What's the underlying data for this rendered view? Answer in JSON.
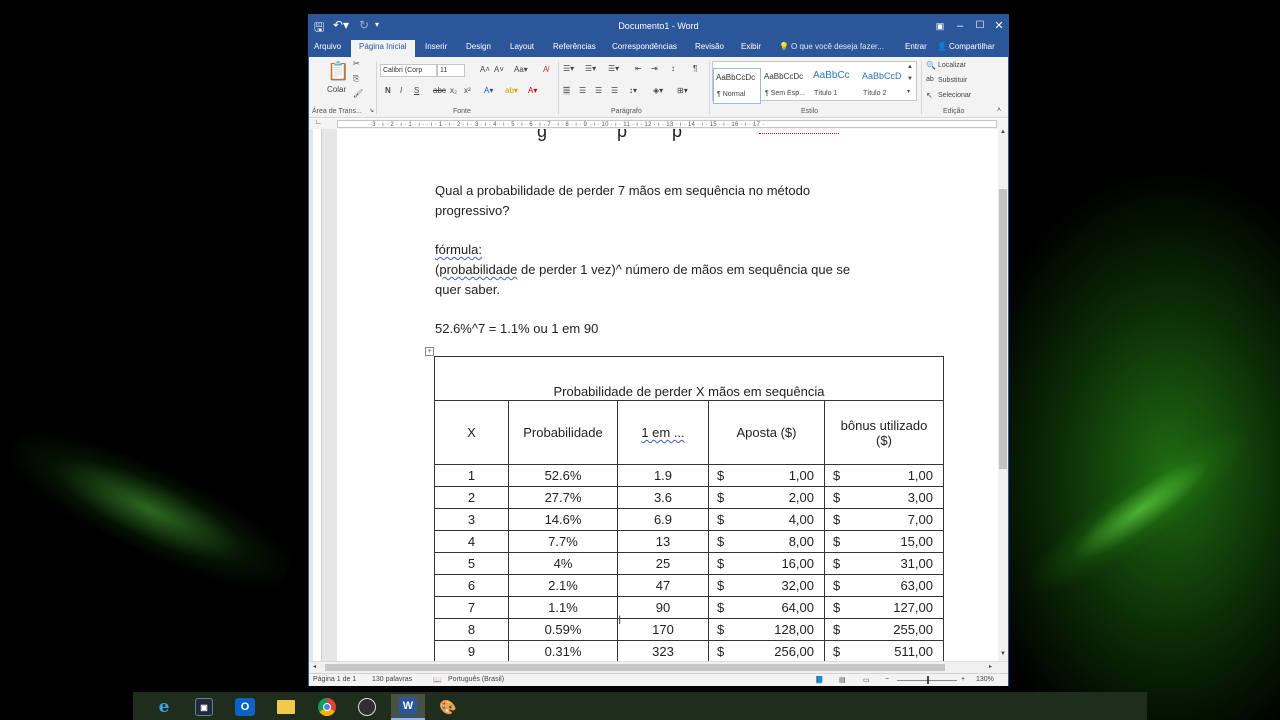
{
  "window": {
    "title": "Documento1 - Word",
    "quick_access": {
      "save_icon": "save-icon",
      "undo_icon": "undo-icon",
      "redo_icon": "redo-icon",
      "customize_icon": "customize-icon"
    },
    "controls": {
      "ribbon_display_icon": "ribbon-display-icon",
      "minimize_icon": "minimize-icon",
      "maximize_icon": "maximize-icon",
      "close_icon": "close-icon"
    }
  },
  "tabs": [
    "Arquivo",
    "Página Inicial",
    "Inserir",
    "Design",
    "Layout",
    "Referências",
    "Correspondências",
    "Revisão",
    "Exibir"
  ],
  "tell_me": "O que você deseja fazer...",
  "signin": "Entrar",
  "share": "Compartilhar",
  "ribbon": {
    "clipboard": {
      "paste_label": "Colar",
      "group_label": "Área de Trans..."
    },
    "font": {
      "font_name": "Calibri (Corp",
      "font_size": "11",
      "group_label": "Fonte"
    },
    "paragraph": {
      "group_label": "Parágrafo"
    },
    "styles": {
      "items": [
        {
          "preview": "AaBbCcDc",
          "name": "¶ Normal"
        },
        {
          "preview": "AaBbCcDc",
          "name": "¶ Sem Esp..."
        },
        {
          "preview": "AaBbCc",
          "name": "Título 1"
        },
        {
          "preview": "AaBbCcD",
          "name": "Título 2"
        }
      ],
      "group_label": "Estilo"
    },
    "editing": {
      "find": "Localizar",
      "replace": "Substituir",
      "select": "Selecionar",
      "group_label": "Edição"
    }
  },
  "ruler": "· 3 · ı · 2 · ı · 1 · ı ·   · ı · 1 · ı · 2 · ı · 3 · ı · 4 · ı · 5 · ı · 6 · ı · 7 · ı · 8 · ı · 9 · ı · 10 · ı · 11 · ı · 12 · ı · 13 · ı · 14 · ı · 15 · ı · 16 · ı · 17 ·",
  "document": {
    "question_line1": "Qual a probabilidade de perder 7 mãos em sequência no método",
    "question_line2": "progressivo?",
    "formula_label": "fórmula:",
    "formula_paren": "(",
    "formula_squig": "probabilidade",
    "formula_rest": " de perder 1 vez)^ número de mãos em sequência que se",
    "formula_line2": "quer saber.",
    "result": "52.6%^7 = 1.1% ou 1 em 90",
    "table": {
      "caption": "Probabilidade de perder X mãos em sequência",
      "headers": [
        "X",
        "Probabilidade",
        "1 em ...",
        "Aposta ($)",
        "bônus utilizado ($)"
      ],
      "rows": [
        [
          "1",
          "52.6%",
          "1.9",
          "$",
          "1,00",
          "$",
          "1,00"
        ],
        [
          "2",
          "27.7%",
          "3.6",
          "$",
          "2,00",
          "$",
          "3,00"
        ],
        [
          "3",
          "14.6%",
          "6.9",
          "$",
          "4,00",
          "$",
          "7,00"
        ],
        [
          "4",
          "7.7%",
          "13",
          "$",
          "8,00",
          "$",
          "15,00"
        ],
        [
          "5",
          "4%",
          "25",
          "$",
          "16,00",
          "$",
          "31,00"
        ],
        [
          "6",
          "2.1%",
          "47",
          "$",
          "32,00",
          "$",
          "63,00"
        ],
        [
          "7",
          "1.1%",
          "90",
          "$",
          "64,00",
          "$",
          "127,00"
        ],
        [
          "8",
          "0.59%",
          "170",
          "$",
          "128,00",
          "$",
          "255,00"
        ],
        [
          "9",
          "0.31%",
          "323",
          "$",
          "256,00",
          "$",
          "511,00"
        ]
      ]
    }
  },
  "status": {
    "page": "Página 1 de 1",
    "words": "130 palavras",
    "language": "Português (Brasil)",
    "zoom": "130%"
  },
  "taskbar": [
    "internet-explorer-icon",
    "terminal-icon",
    "outlook-icon",
    "file-explorer-icon",
    "chrome-icon",
    "obs-icon",
    "word-icon",
    "paint-icon"
  ]
}
